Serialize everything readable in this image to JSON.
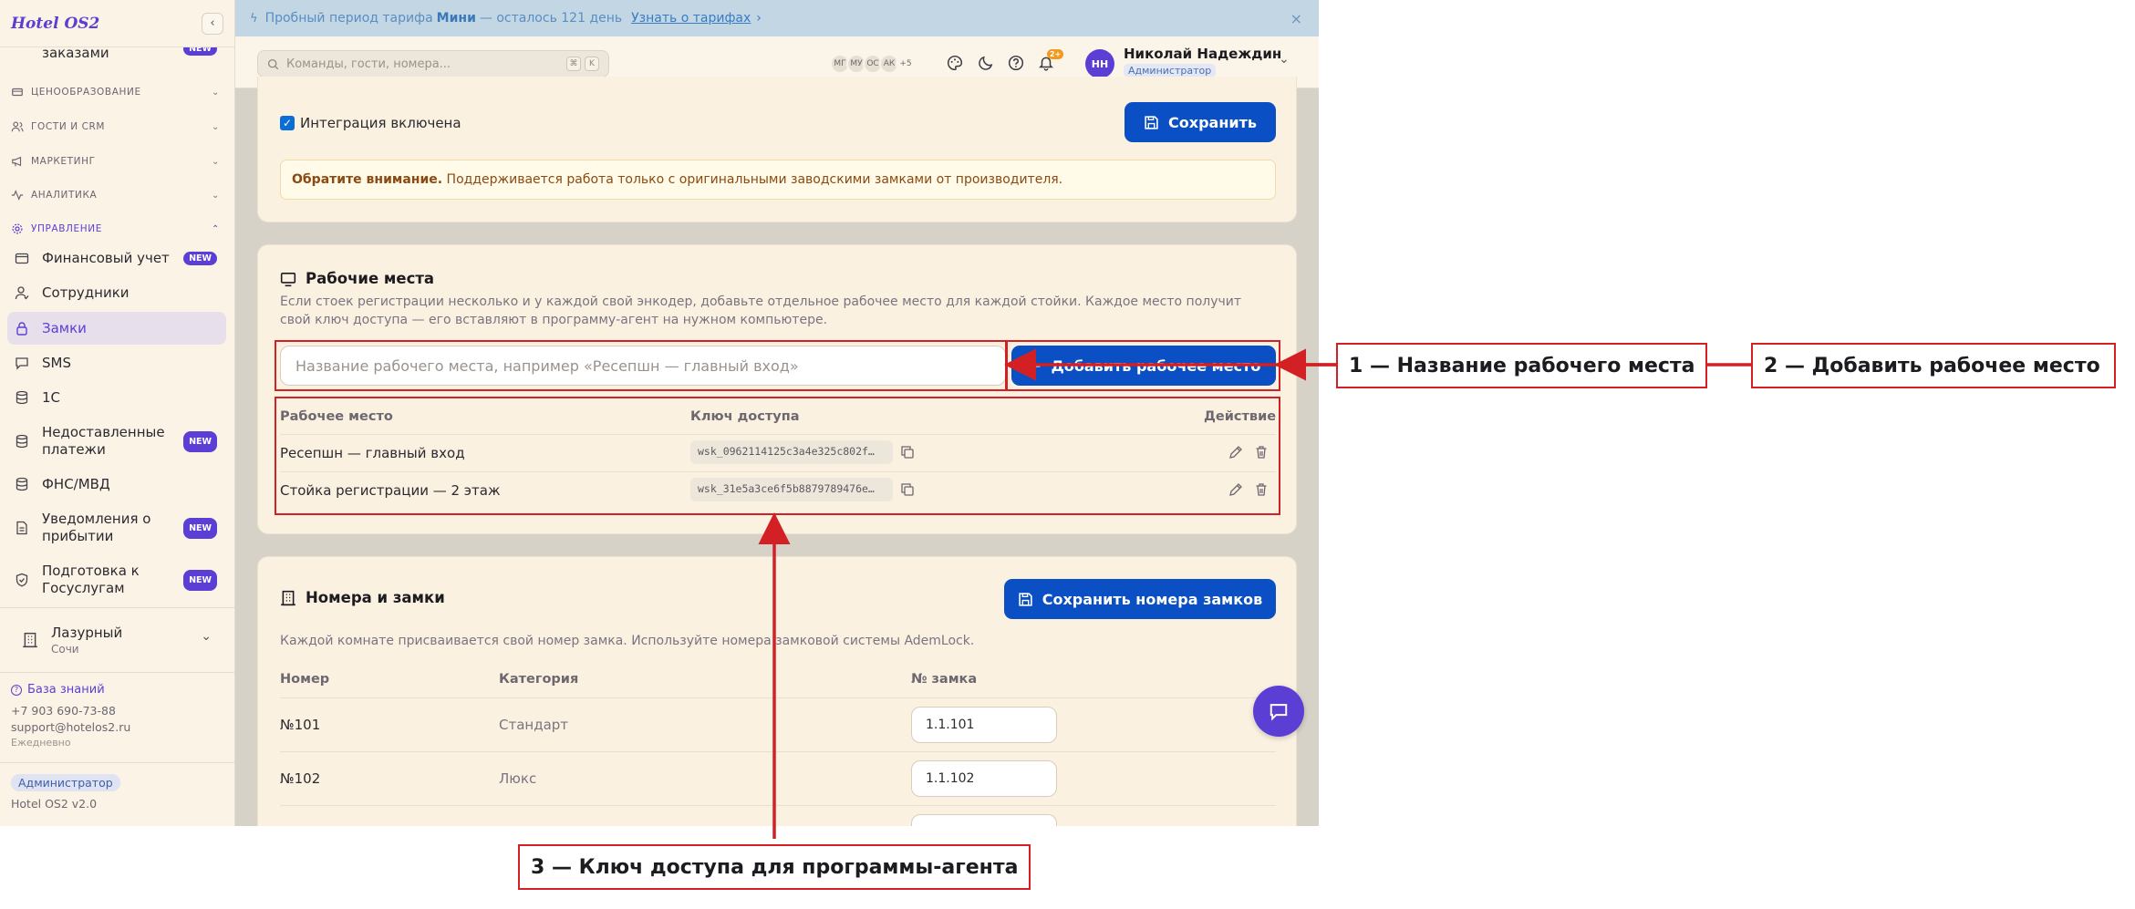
{
  "sidebar": {
    "logo": "Hotel OS2",
    "collapse_icon": "chevron-left-icon",
    "partial_item": "заказами",
    "sections": [
      {
        "label": "ЦЕНООБРАЗОВАНИЕ",
        "icon": "price-icon"
      },
      {
        "label": "ГОСТИ И CRM",
        "icon": "users-icon"
      },
      {
        "label": "МАРКЕТИНГ",
        "icon": "megaphone-icon"
      },
      {
        "label": "АНАЛИТИКА",
        "icon": "chart-icon"
      },
      {
        "label": "УПРАВЛЕНИЕ",
        "icon": "gear-icon"
      }
    ],
    "items": [
      {
        "label": "Финансовый учет",
        "icon": "wallet-icon",
        "badge": "NEW"
      },
      {
        "label": "Сотрудники",
        "icon": "user-icon",
        "badge": ""
      },
      {
        "label": "Замки",
        "icon": "lock-icon",
        "badge": ""
      },
      {
        "label": "SMS",
        "icon": "message-icon",
        "badge": ""
      },
      {
        "label": "1С",
        "icon": "database-icon",
        "badge": ""
      },
      {
        "label": "Недоставленные платежи",
        "icon": "database-icon",
        "badge": "NEW"
      },
      {
        "label": "ФНС/МВД",
        "icon": "database-icon",
        "badge": ""
      },
      {
        "label": "Уведомления о прибытии",
        "icon": "document-icon",
        "badge": "NEW"
      },
      {
        "label": "Подготовка к Госуслугам",
        "icon": "shield-icon",
        "badge": "NEW"
      }
    ],
    "hotel": {
      "name": "Лазурный",
      "city": "Сочи"
    },
    "footer": {
      "kb_label": "База знаний",
      "phone": "+7 903 690-73-88",
      "email": "support@hotelos2.ru",
      "hours": "Ежедневно",
      "role_badge": "Администратор",
      "version": "Hotel OS2 v2.0"
    }
  },
  "banner": {
    "prefix": "Пробный период тарифа ",
    "plan": "Мини",
    "suffix": " — осталось 121 день",
    "link": "Узнать о тарифах",
    "link_arrow": "›",
    "close": "×"
  },
  "header": {
    "search_placeholder": "Команды, гости, номера...",
    "kbd1": "⌘",
    "kbd2": "K",
    "avatars": [
      "МГ",
      "МУ",
      "ОС",
      "АК"
    ],
    "avatars_more": "+5",
    "notif_count": "2+",
    "user_initials": "НН",
    "user_name": "Николай Надеждин",
    "user_role": "Администратор"
  },
  "integration": {
    "checkbox_label": "Интеграция включена",
    "checked": true,
    "save_label": "Сохранить",
    "notice_bold": "Обратите внимание.",
    "notice_text": " Поддерживается работа только с оригинальными заводскими замками от производителя."
  },
  "workplaces": {
    "title": "Рабочие места",
    "desc": "Если стоек регистрации несколько и у каждой свой энкодер, добавьте отдельное рабочее место для каждой стойки. Каждое место получит свой ключ доступа — его вставляют в программу-агент на нужном компьютере.",
    "input_placeholder": "Название рабочего места, например «Ресепшн — главный вход»",
    "add_label": "Добавить рабочее место",
    "add_icon": "plus-icon",
    "columns": [
      "Рабочее место",
      "Ключ доступа",
      "Действие"
    ],
    "rows": [
      {
        "name": "Ресепшн — главный вход",
        "key": "wsk_0962114125c3a4e325c802f…"
      },
      {
        "name": "Стойка регистрации — 2 этаж",
        "key": "wsk_31e5a3ce6f5b8879789476e…"
      }
    ]
  },
  "rooms": {
    "title": "Номера и замки",
    "save_label": "Сохранить номера замков",
    "desc": "Каждой комнате присваивается свой номер замка. Используйте номера замковой системы AdemLock.",
    "columns": [
      "Номер",
      "Категория",
      "№ замка"
    ],
    "rows": [
      {
        "room": "№101",
        "category": "Стандарт",
        "lock": "1.1.101"
      },
      {
        "room": "№102",
        "category": "Люкс",
        "lock": "1.1.102"
      }
    ]
  },
  "annotations": {
    "a1": "1 — Название рабочего места",
    "a2": "2 — Добавить рабочее место",
    "a3": "3 — Ключ доступа для программы-агента",
    "color": "#d22025"
  },
  "colors": {
    "accent": "#5b3fd4",
    "primary_button": "#0b4fc4",
    "page_bg": "#fbf1e1"
  }
}
